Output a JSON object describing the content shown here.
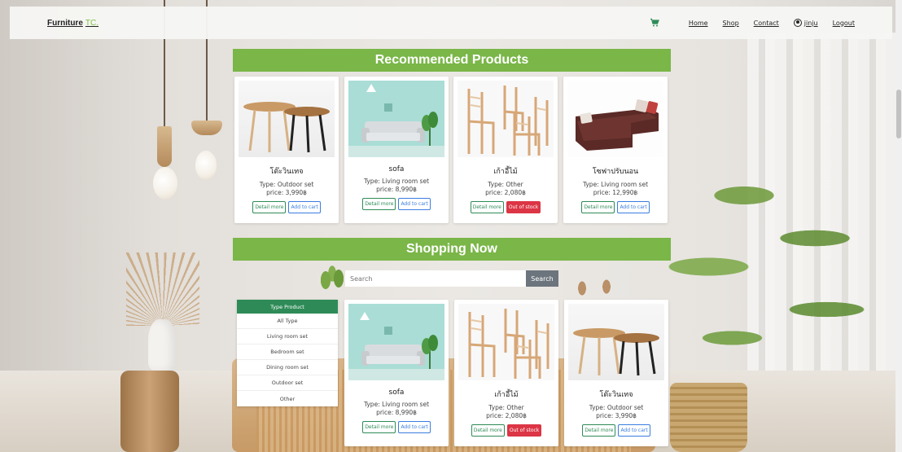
{
  "nav": {
    "brand": "Furniture",
    "brand_suffix": "TC.",
    "links": [
      "Home",
      "Shop",
      "Contact"
    ],
    "user": "jinju",
    "logout": "Logout"
  },
  "recommended": {
    "title": "Recommended Products",
    "products": [
      {
        "name": "โต๊ะวินเทจ",
        "type": "Type: Outdoor set",
        "price": "price: 3,990฿",
        "detail": "Detail more",
        "action": "Add to cart",
        "in_stock": true,
        "image": "table-image"
      },
      {
        "name": "sofa",
        "type": "Type: Living room set",
        "price": "price: 8,990฿",
        "detail": "Detail more",
        "action": "Add to cart",
        "in_stock": true,
        "image": "sofa-image"
      },
      {
        "name": "เก้าอี้ไม้",
        "type": "Type: Other",
        "price": "price: 2,080฿",
        "detail": "Detail more",
        "action": "Out of stock",
        "in_stock": false,
        "image": "chair-image"
      },
      {
        "name": "โซฟาปรับนอน",
        "type": "Type: Living room set",
        "price": "price: 12,990฿",
        "detail": "Detail more",
        "action": "Add to cart",
        "in_stock": true,
        "image": "sectional-image"
      }
    ]
  },
  "shopping": {
    "title": "Shopping Now",
    "search_placeholder": "Search",
    "search_button": "Search",
    "filter": {
      "header": "Type Product",
      "options": [
        "All Type",
        "Living room set",
        "Bedroom set",
        "Dining room set",
        "Outdoor set",
        "Other"
      ]
    },
    "products": [
      {
        "name": "sofa",
        "type": "Type: Living room set",
        "price": "price: 8,990฿",
        "detail": "Detail more",
        "action": "Add to cart",
        "in_stock": true,
        "image": "sofa-image"
      },
      {
        "name": "เก้าอี้ไม้",
        "type": "Type: Other",
        "price": "price: 2,080฿",
        "detail": "Detail more",
        "action": "Out of stock",
        "in_stock": false,
        "image": "chair-image"
      },
      {
        "name": "โต๊ะวินเทจ",
        "type": "Type: Outdoor set",
        "price": "price: 3,990฿",
        "detail": "Detail more",
        "action": "Add to cart",
        "in_stock": true,
        "image": "table-image"
      }
    ]
  },
  "colors": {
    "accent_green": "#7ab648",
    "filter_green": "#2e8b57",
    "danger": "#dc3545",
    "link_blue": "#3b7de0"
  }
}
